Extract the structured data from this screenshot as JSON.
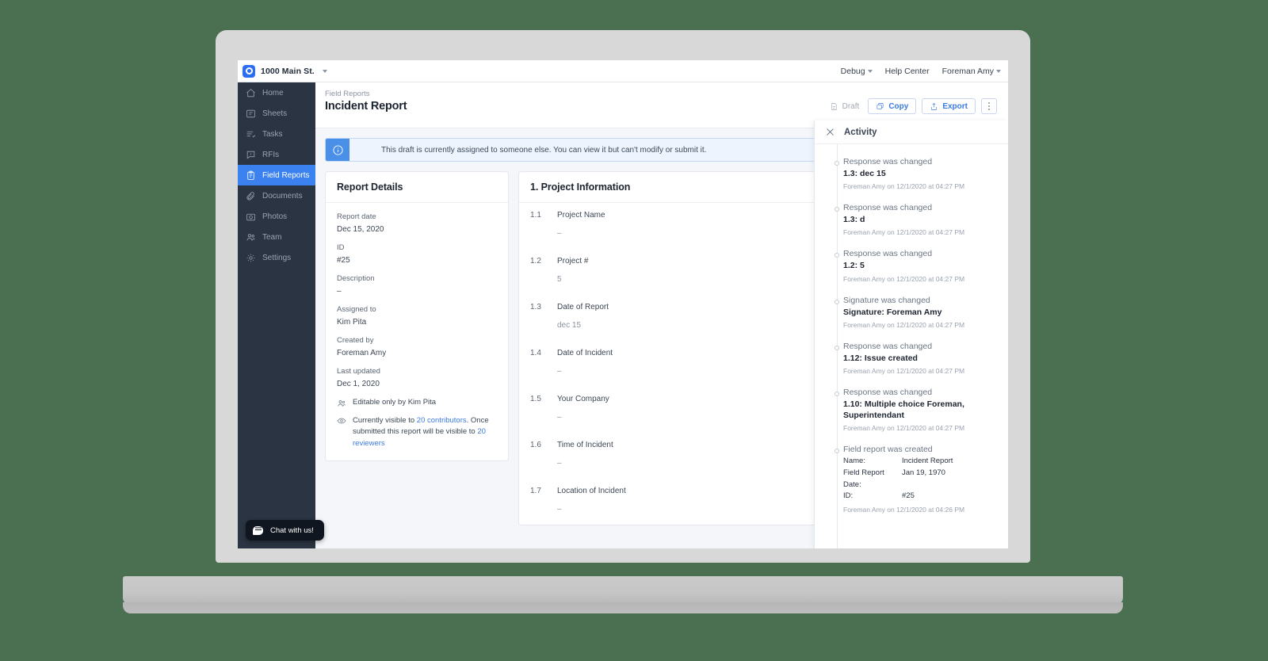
{
  "topbar": {
    "project_name": "1000 Main St.",
    "logo_icon": "circle-logo-icon",
    "links": [
      {
        "label": "Debug",
        "has_caret": true
      },
      {
        "label": "Help Center",
        "has_caret": false
      },
      {
        "label": "Foreman Amy",
        "has_caret": true
      }
    ]
  },
  "sidebar": {
    "items": [
      {
        "label": "Home",
        "icon": "home-icon",
        "active": false
      },
      {
        "label": "Sheets",
        "icon": "sheets-icon",
        "active": false
      },
      {
        "label": "Tasks",
        "icon": "tasks-icon",
        "active": false
      },
      {
        "label": "RFIs",
        "icon": "rfis-icon",
        "active": false
      },
      {
        "label": "Field Reports",
        "icon": "clipboard-icon",
        "active": true
      },
      {
        "label": "Documents",
        "icon": "paperclip-icon",
        "active": false
      },
      {
        "label": "Photos",
        "icon": "camera-icon",
        "active": false
      },
      {
        "label": "Team",
        "icon": "people-icon",
        "active": false
      },
      {
        "label": "Settings",
        "icon": "gear-icon",
        "active": false
      }
    ],
    "chat_widget": {
      "label": "Chat with us!",
      "icon": "chat-bubble-icon"
    }
  },
  "page": {
    "breadcrumb": "Field Reports",
    "title": "Incident Report",
    "actions": {
      "status_label": "Draft",
      "copy_label": "Copy",
      "export_label": "Export",
      "more_label": "More options"
    },
    "banner": {
      "icon": "info-icon",
      "text": "This draft is currently assigned to someone else. You can view it but can't modify or submit it."
    }
  },
  "report_details": {
    "title": "Report Details",
    "fields": [
      {
        "label": "Report date",
        "value": "Dec 15, 2020"
      },
      {
        "label": "ID",
        "value": "#25"
      },
      {
        "label": "Description",
        "value": "–"
      },
      {
        "label": "Assigned to",
        "value": "Kim Pita"
      },
      {
        "label": "Created by",
        "value": "Foreman Amy"
      },
      {
        "label": "Last updated",
        "value": "Dec 1, 2020"
      }
    ],
    "editable_note": "Editable only by Kim Pita",
    "visibility_note": {
      "prefix": "Currently visible to ",
      "link1": "20 contributors",
      "middle": ". Once submitted this report will be visible to ",
      "link2": "20 reviewers"
    }
  },
  "project_information": {
    "title": "1. Project Information",
    "questions": [
      {
        "number": "1.1",
        "label": "Project Name",
        "answer": "–"
      },
      {
        "number": "1.2",
        "label": "Project #",
        "answer": "5"
      },
      {
        "number": "1.3",
        "label": "Date of Report",
        "answer": "dec 15"
      },
      {
        "number": "1.4",
        "label": "Date of Incident",
        "answer": "–"
      },
      {
        "number": "1.5",
        "label": "Your Company",
        "answer": "–"
      },
      {
        "number": "1.6",
        "label": "Time of Incident",
        "answer": "–"
      },
      {
        "number": "1.7",
        "label": "Location of Incident",
        "answer": "–"
      }
    ]
  },
  "activity": {
    "title": "Activity",
    "close_icon": "close-icon",
    "entries": [
      {
        "action": "Response was changed",
        "detail": "1.3: dec 15",
        "meta": "Foreman Amy on 12/1/2020 at 04:27 PM"
      },
      {
        "action": "Response was changed",
        "detail": "1.3: d",
        "meta": "Foreman Amy on 12/1/2020 at 04:27 PM"
      },
      {
        "action": "Response was changed",
        "detail": "1.2: 5",
        "meta": "Foreman Amy on 12/1/2020 at 04:27 PM"
      },
      {
        "action": "Signature was changed",
        "detail": "Signature: Foreman Amy",
        "meta": "Foreman Amy on 12/1/2020 at 04:27 PM"
      },
      {
        "action": "Response was changed",
        "detail": "1.12: Issue created",
        "meta": "Foreman Amy on 12/1/2020 at 04:27 PM"
      },
      {
        "action": "Response was changed",
        "detail": "1.10: Multiple choice Foreman, Superintendant",
        "meta": "Foreman Amy on 12/1/2020 at 04:27 PM"
      },
      {
        "action": "Field report was created",
        "detail": "",
        "meta": "Foreman Amy on 12/1/2020 at 04:26 PM",
        "kv": [
          {
            "k": "Name:",
            "v": "Incident Report"
          },
          {
            "k": "Field Report Date:",
            "v": "Jan 19, 1970"
          },
          {
            "k": "ID:",
            "v": "#25"
          }
        ]
      }
    ]
  },
  "colors": {
    "page_background": "#4a7051",
    "sidebar": "#2b3442",
    "accent": "#3b82f0",
    "link": "#3b7ae0",
    "banner_bg": "#eef4fd",
    "banner_icon_bg": "#4a90e8"
  }
}
